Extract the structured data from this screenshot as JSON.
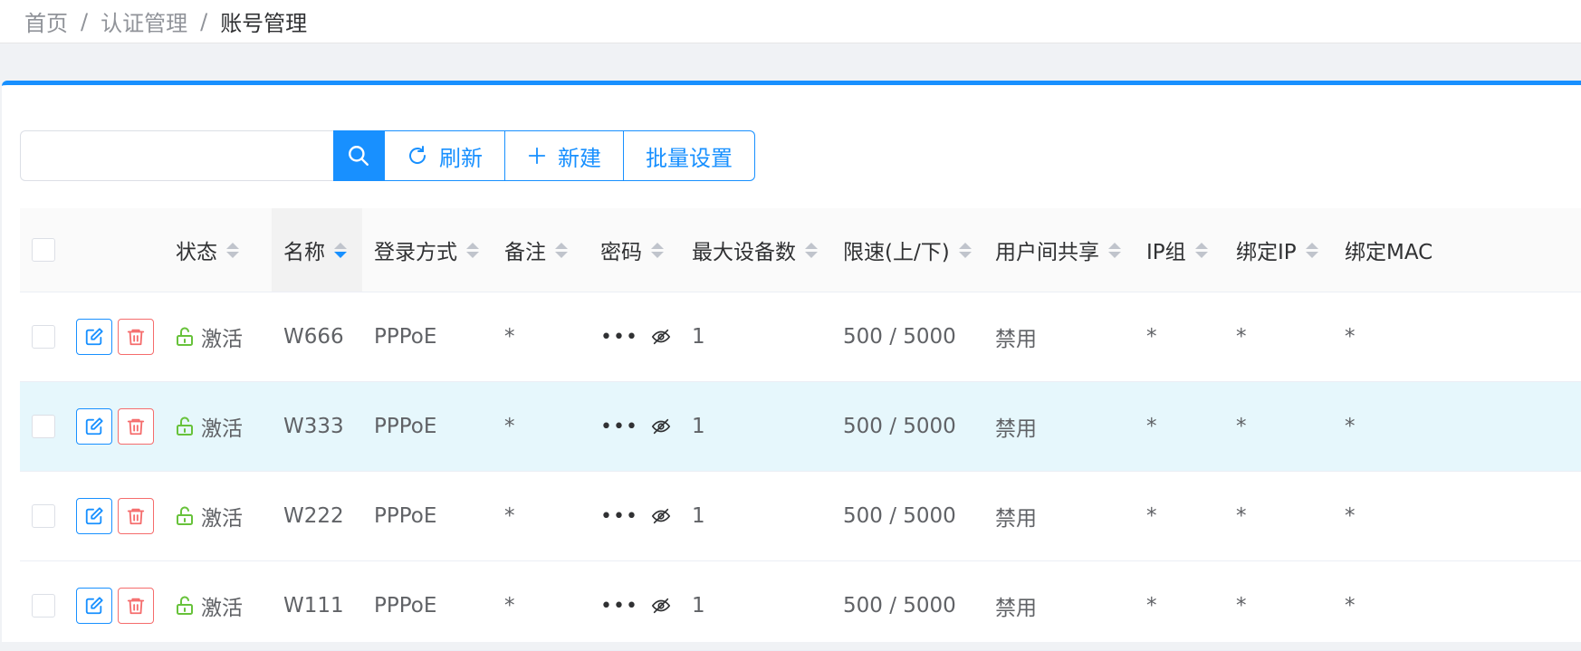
{
  "breadcrumb": {
    "home": "首页",
    "section": "认证管理",
    "current": "账号管理",
    "separator": "/"
  },
  "toolbar": {
    "search_placeholder": "",
    "refresh_label": "刷新",
    "new_label": "新建",
    "batch_label": "批量设置"
  },
  "table": {
    "columns": {
      "status": "状态",
      "name": "名称",
      "login": "登录方式",
      "remark": "备注",
      "password": "密码",
      "max_devices": "最大设备数",
      "speed": "限速(上/下)",
      "share": "用户间共享",
      "ip_group": "IP组",
      "bind_ip": "绑定IP",
      "bind_mac": "绑定MAC"
    },
    "sort_active_column": "name",
    "rows": [
      {
        "status": "激活",
        "name": "W666",
        "login": "PPPoE",
        "remark": "*",
        "password": "•••",
        "max_devices": "1",
        "speed": "500 / 5000",
        "share": "禁用",
        "ip_group": "*",
        "bind_ip": "*",
        "bind_mac": "*"
      },
      {
        "status": "激活",
        "name": "W333",
        "login": "PPPoE",
        "remark": "*",
        "password": "•••",
        "max_devices": "1",
        "speed": "500 / 5000",
        "share": "禁用",
        "ip_group": "*",
        "bind_ip": "*",
        "bind_mac": "*"
      },
      {
        "status": "激活",
        "name": "W222",
        "login": "PPPoE",
        "remark": "*",
        "password": "•••",
        "max_devices": "1",
        "speed": "500 / 5000",
        "share": "禁用",
        "ip_group": "*",
        "bind_ip": "*",
        "bind_mac": "*"
      },
      {
        "status": "激活",
        "name": "W111",
        "login": "PPPoE",
        "remark": "*",
        "password": "•••",
        "max_devices": "1",
        "speed": "500 / 5000",
        "share": "禁用",
        "ip_group": "*",
        "bind_ip": "*",
        "bind_mac": "*"
      }
    ]
  },
  "colors": {
    "primary": "#1890ff",
    "danger": "#f56c6c",
    "success": "#67c23a",
    "highlight_row": "#e6f7fc"
  },
  "icons": {
    "search": "search-icon",
    "refresh": "refresh-icon",
    "new": "plus-icon",
    "edit": "edit-icon",
    "delete": "trash-icon",
    "status": "unlock-icon",
    "password_toggle": "eye-off-icon"
  }
}
